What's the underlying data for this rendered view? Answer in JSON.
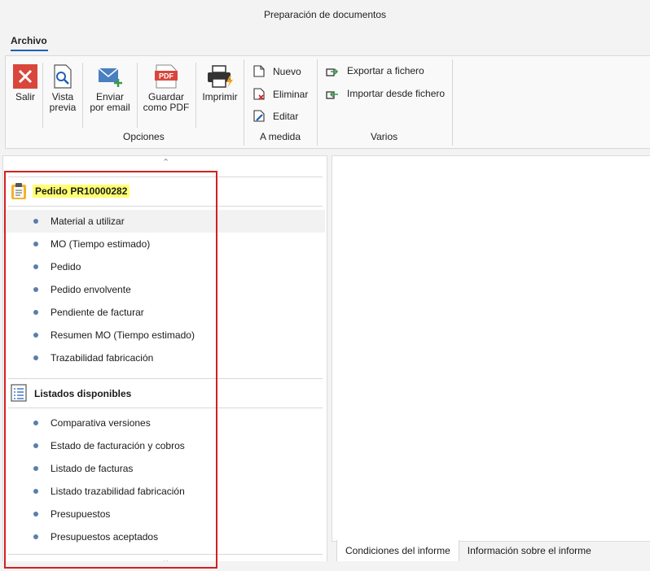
{
  "window": {
    "title": "Preparación de documentos"
  },
  "menu": {
    "tab_label": "Archivo"
  },
  "ribbon": {
    "groups": {
      "opciones": {
        "label": "Opciones",
        "buttons": {
          "salir": "Salir",
          "vista_previa_1": "Vista",
          "vista_previa_2": "previa",
          "enviar_1": "Enviar",
          "enviar_2": "por email",
          "guardar_1": "Guardar",
          "guardar_2": "como PDF",
          "pdf_icon_text": "PDF",
          "imprimir": "Imprimir"
        }
      },
      "a_medida": {
        "label": "A medida",
        "buttons": {
          "nuevo": "Nuevo",
          "eliminar": "Eliminar",
          "editar": "Editar"
        }
      },
      "varios": {
        "label": "Varios",
        "buttons": {
          "exportar": "Exportar a fichero",
          "importar": "Importar desde fichero"
        }
      }
    }
  },
  "left_panel": {
    "pedido_section": {
      "title": "Pedido PR10000282",
      "items": [
        "Material a utilizar",
        "MO (Tiempo estimado)",
        "Pedido",
        "Pedido envolvente",
        "Pendiente de facturar",
        "Resumen MO (Tiempo estimado)",
        "Trazabilidad fabricación"
      ]
    },
    "listados_section": {
      "title": "Listados disponibles",
      "items": [
        "Comparativa versiones",
        "Estado de facturación y cobros",
        "Listado de facturas",
        "Listado trazabilidad fabricación",
        "Presupuestos",
        "Presupuestos aceptados"
      ]
    }
  },
  "right_panel": {
    "tabs": [
      "Condiciones del informe",
      "Información sobre el informe"
    ]
  },
  "colors": {
    "accent": "#1f5fb5",
    "highlight": "#ffff70",
    "annotation_border": "#d42020",
    "bullet": "#5a7fa8"
  }
}
